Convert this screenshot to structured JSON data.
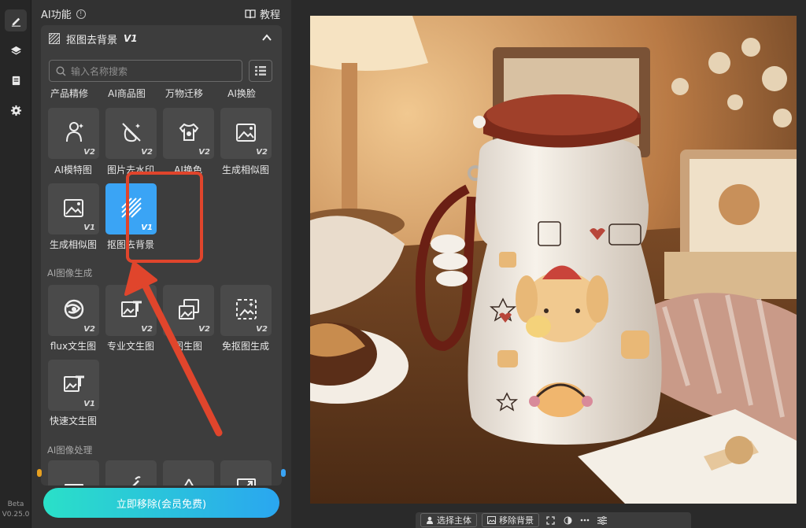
{
  "sidebar": {
    "tools": [
      {
        "icon": "edit-icon"
      },
      {
        "icon": "layers-icon"
      },
      {
        "icon": "document-icon"
      },
      {
        "icon": "settings-icon"
      }
    ],
    "beta_label": "Beta",
    "version": "V0.25.0"
  },
  "panel": {
    "title": "AI功能",
    "tutorial_label": "教程",
    "section_title": "抠图去背景",
    "section_version": "V1",
    "search_placeholder": "输入名称搜索",
    "categories": [
      "产品精修",
      "AI商品图",
      "万物迁移",
      "AI换脸"
    ],
    "tools_row1": [
      {
        "label": "AI模特图",
        "version": "V2",
        "icon": "model-person-icon"
      },
      {
        "label": "图片去水印",
        "version": "V2",
        "icon": "remove-watermark-icon"
      },
      {
        "label": "AI换色",
        "version": "V2",
        "icon": "recolor-shirt-icon"
      },
      {
        "label": "生成相似图",
        "version": "V2",
        "icon": "similar-image-icon"
      }
    ],
    "tools_row2": [
      {
        "label": "生成相似图",
        "version": "V1",
        "icon": "similar-image-icon"
      },
      {
        "label": "抠图去背景",
        "version": "V1",
        "icon": "cutout-background-icon"
      }
    ],
    "group_image_gen": "AI图像生成",
    "tools_row3": [
      {
        "label": "flux文生图",
        "version": "V2",
        "icon": "flux-swirl-icon"
      },
      {
        "label": "专业文生图",
        "version": "V2",
        "icon": "text-to-image-icon"
      },
      {
        "label": "图生图",
        "version": "V2",
        "icon": "image-to-image-icon"
      },
      {
        "label": "免抠图生成",
        "version": "V2",
        "icon": "no-cutout-generate-icon"
      }
    ],
    "tools_row4": [
      {
        "label": "快速文生图",
        "version": "V1",
        "icon": "text-to-image-icon"
      }
    ],
    "group_image_proc": "AI图像处理",
    "cta_label": "立即移除(会员免费)"
  },
  "toolbar": {
    "select_subject": "选择主体",
    "remove_background": "移除背景"
  },
  "colors": {
    "accent": "#3aa4f5",
    "highlight": "#e0452c",
    "cta_start": "#2ae0c8",
    "cta_end": "#2aa6f0"
  }
}
